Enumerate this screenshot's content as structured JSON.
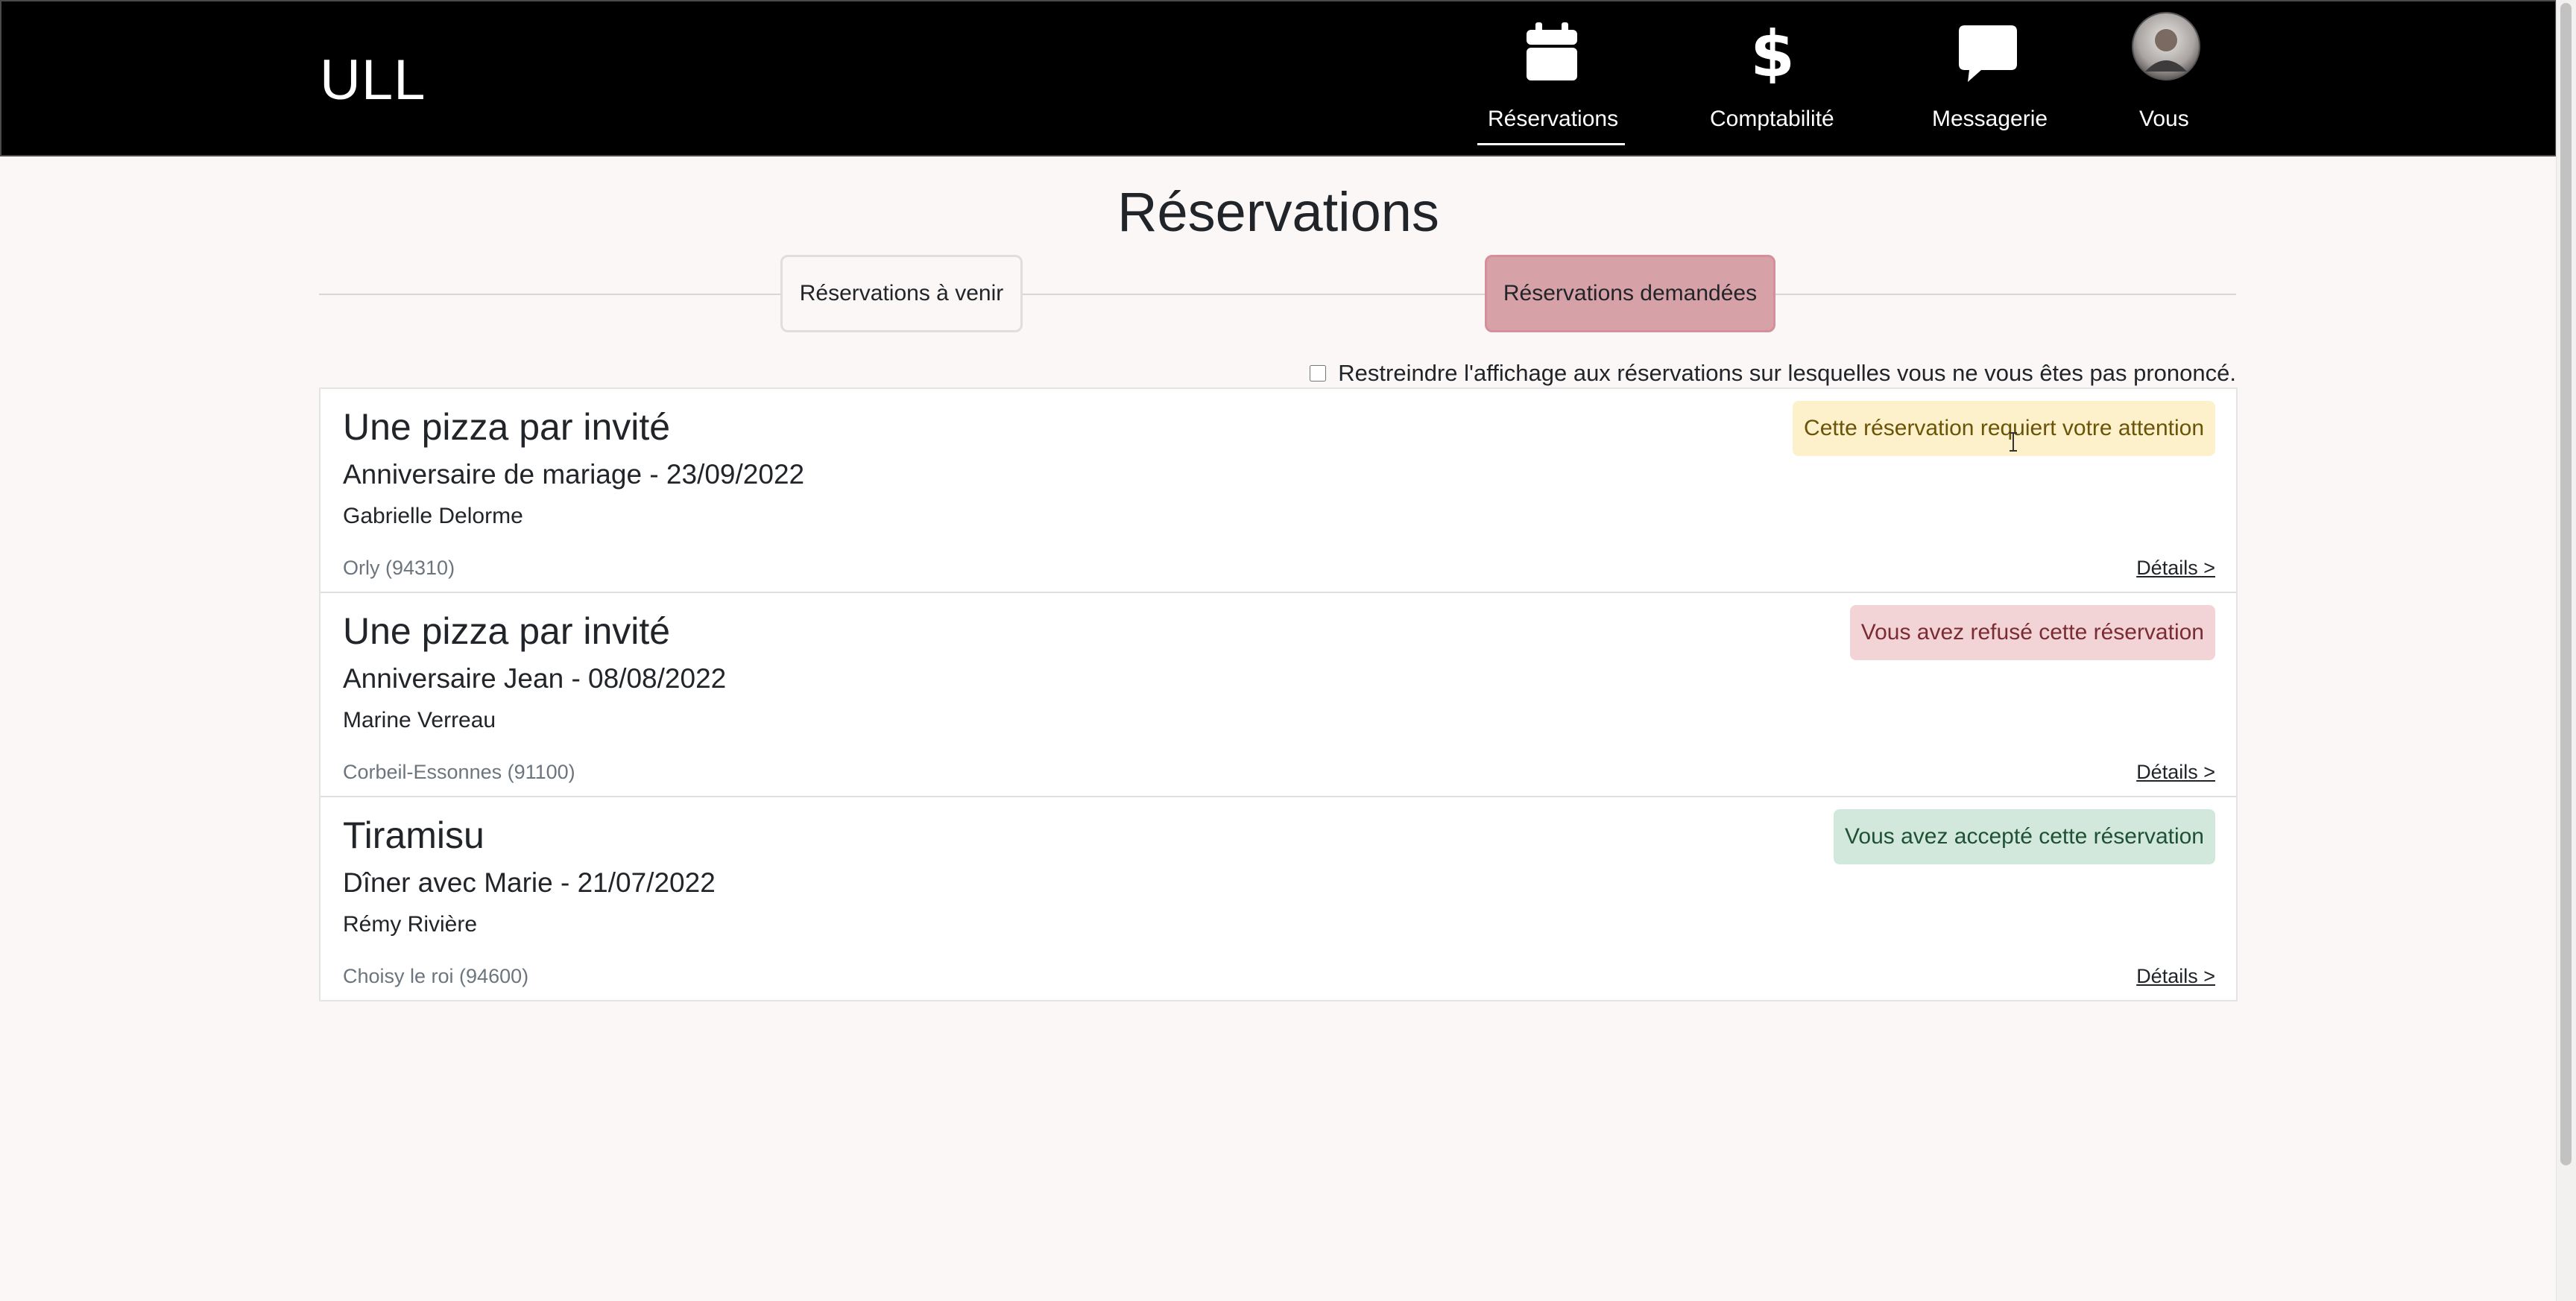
{
  "app": {
    "brand": "ULL"
  },
  "nav": {
    "items": [
      {
        "label": "Réservations",
        "icon": "calendar-icon",
        "active": true
      },
      {
        "label": "Comptabilité",
        "icon": "dollar-icon",
        "active": false
      },
      {
        "label": "Messagerie",
        "icon": "chat-bubble-icon",
        "active": false
      },
      {
        "label": "Vous",
        "icon": "avatar",
        "active": false
      }
    ]
  },
  "page": {
    "title": "Réservations"
  },
  "tabs": [
    {
      "label": "Réservations à venir",
      "active": false
    },
    {
      "label": "Réservations demandées",
      "active": true
    }
  ],
  "filter": {
    "label": "Restreindre l'affichage aux réservations sur lesquelles vous ne vous êtes pas prononcé.",
    "checked": false
  },
  "reservations": [
    {
      "title": "Une pizza par invité",
      "event": "Anniversaire de mariage - 23/09/2022",
      "person": "Gabrielle Delorme",
      "location": "Orly (94310)",
      "details": "Détails >",
      "status": "Cette réservation requiert votre attention",
      "status_kind": "warning",
      "status_bg": "#fcf1cb",
      "status_fg": "#6b5408"
    },
    {
      "title": "Une pizza par invité",
      "event": "Anniversaire Jean - 08/08/2022",
      "person": "Marine Verreau",
      "location": "Corbeil-Essonnes (91100)",
      "details": "Détails >",
      "status": "Vous avez refusé cette réservation",
      "status_kind": "danger",
      "status_bg": "#f2d4d7",
      "status_fg": "#7b2b33"
    },
    {
      "title": "Tiramisu",
      "event": "Dîner avec Marie - 21/07/2022",
      "person": "Rémy Rivière",
      "location": "Choisy le roi (94600)",
      "details": "Détails >",
      "status": "Vous avez accepté cette réservation",
      "status_kind": "success",
      "status_bg": "#d3e8dc",
      "status_fg": "#1f5135"
    }
  ]
}
